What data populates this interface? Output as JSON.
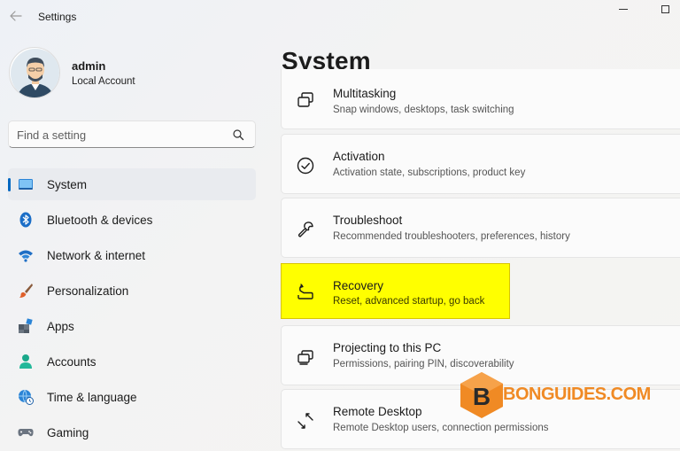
{
  "window": {
    "app_title": "Settings"
  },
  "profile": {
    "name": "admin",
    "account_type": "Local Account"
  },
  "search": {
    "placeholder": "Find a setting"
  },
  "sidebar": {
    "items": [
      {
        "label": "System",
        "icon": "system-display-icon",
        "selected": true
      },
      {
        "label": "Bluetooth & devices",
        "icon": "bluetooth-icon"
      },
      {
        "label": "Network & internet",
        "icon": "wifi-icon"
      },
      {
        "label": "Personalization",
        "icon": "paintbrush-icon"
      },
      {
        "label": "Apps",
        "icon": "apps-icon"
      },
      {
        "label": "Accounts",
        "icon": "person-icon"
      },
      {
        "label": "Time & language",
        "icon": "globe-clock-icon"
      },
      {
        "label": "Gaming",
        "icon": "gamepad-icon"
      }
    ]
  },
  "main": {
    "title": "System",
    "cards": [
      {
        "title": "Multitasking",
        "subtitle": "Snap windows, desktops, task switching",
        "icon": "multitasking-icon"
      },
      {
        "title": "Activation",
        "subtitle": "Activation state, subscriptions, product key",
        "icon": "check-circle-icon"
      },
      {
        "title": "Troubleshoot",
        "subtitle": "Recommended troubleshooters, preferences, history",
        "icon": "wrench-icon"
      },
      {
        "title": "Recovery",
        "subtitle": "Reset, advanced startup, go back",
        "icon": "recovery-icon",
        "highlighted": true
      },
      {
        "title": "Projecting to this PC",
        "subtitle": "Permissions, pairing PIN, discoverability",
        "icon": "projecting-icon"
      },
      {
        "title": "Remote Desktop",
        "subtitle": "Remote Desktop users, connection permissions",
        "icon": "remote-desktop-icon"
      }
    ]
  },
  "watermark": {
    "text": "BONGUIDES.COM",
    "letter": "B"
  },
  "colors": {
    "accent": "#0067c0",
    "highlight": "#ffff00",
    "watermark": "#f08a24"
  }
}
